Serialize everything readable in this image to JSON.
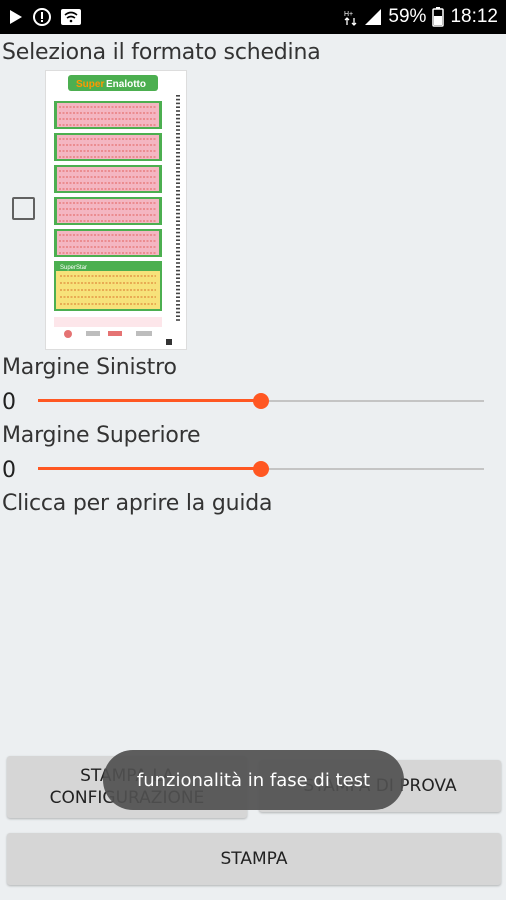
{
  "status_bar": {
    "battery_percent": "59%",
    "time": "18:12",
    "icons": [
      "play-icon",
      "notification-icon",
      "wifi-icon",
      "data-arrows-icon",
      "signal-icon",
      "battery-icon"
    ]
  },
  "main": {
    "format_label": "Seleziona il formato schedina",
    "ticket": {
      "brand": "SuperEnalotto",
      "brand_super": "Super",
      "brand_rest": "Enalotto",
      "star_label": "SuperStar",
      "checked": false
    },
    "margin_left": {
      "label": "Margine Sinistro",
      "value": "0",
      "slider_fraction": 0.5
    },
    "margin_top": {
      "label": "Margine Superiore",
      "value": "0",
      "slider_fraction": 0.5
    },
    "guide_link": "Clicca per aprire la guida"
  },
  "buttons": {
    "print_config": "STAMPA LA CONFIGURAZIONE",
    "print_test": "STAMPA DI PROVA",
    "print": "STAMPA"
  },
  "toast": {
    "message": "funzionalità in fase di test"
  },
  "colors": {
    "accent": "#ff5722",
    "status_bar_bg": "#000000",
    "background": "#eceff1",
    "button_bg": "#d6d6d6",
    "ticket_green": "#4caf50",
    "ticket_pink": "#f4b6c2",
    "ticket_yellow": "#f7e27a"
  }
}
